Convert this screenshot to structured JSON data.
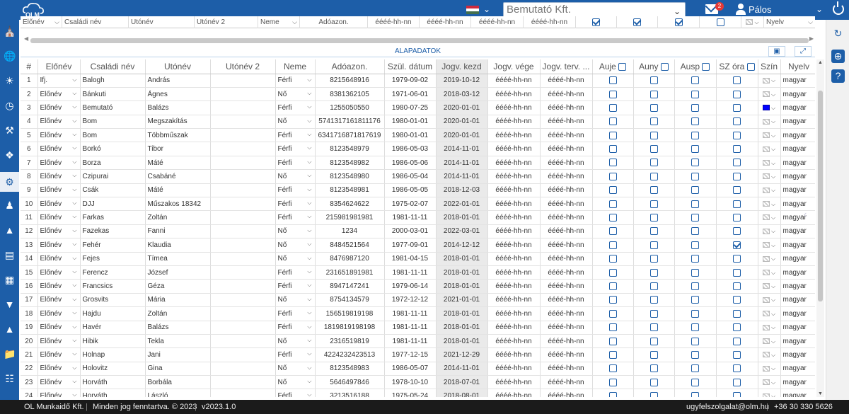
{
  "app": {
    "logo_text": "OLM",
    "company": "Bemutató Kft.",
    "mail_count": "2",
    "user_name": "Pálos"
  },
  "colors": {
    "brand": "#1d5ea8",
    "footer": "#1b1b1b",
    "badge": "#e53935",
    "jogv_bg": "#eaeaea"
  },
  "filter": {
    "eloneve": "Előnév",
    "csaladi": "Családi név",
    "utonev": "Utónév",
    "utonev2": "Utónév 2",
    "neme": "Neme",
    "adoazon": "Adóazon.",
    "date1": "éééé-hh-nn",
    "date2": "éééé-hh-nn",
    "date3": "éééé-hh-nn",
    "date4": "éééé-hh-nn",
    "nyelv": "Nyelv"
  },
  "section_title": "ALAPADATOK",
  "columns": {
    "idx": "#",
    "elonev": "Előnév",
    "csaladi": "Családi név",
    "utonev": "Utónév",
    "utonev2": "Utónév 2",
    "neme": "Neme",
    "adoazon": "Adóazon.",
    "szul": "Szül. dátum",
    "jogv_kezd": "Jogv. kezd",
    "jogv_vege": "Jogv. vége",
    "jogv_terv": "Jogv. terv. ...",
    "auje": "Auje",
    "auny": "Auny",
    "ausp": "Ausp",
    "sz_ora": "SZ óra",
    "szin": "Szín",
    "nyelv": "Nyelv"
  },
  "rows": [
    {
      "n": "1",
      "elonev": "Ifj.",
      "csaladi": "Balogh",
      "utonev": "András",
      "utonev2": "",
      "neme": "Férfi",
      "adoazon": "8215648916",
      "szul": "1979-09-02",
      "kezd": "2019-10-12",
      "vege": "éééé-hh-nn",
      "terv": "éééé-hh-nn",
      "sz": false,
      "blue": false,
      "nyelv": "magyar"
    },
    {
      "n": "2",
      "elonev": "Előnév",
      "csaladi": "Bánkuti",
      "utonev": "Ágnes",
      "utonev2": "",
      "neme": "Nő",
      "adoazon": "8381362105",
      "szul": "1971-06-01",
      "kezd": "2018-03-12",
      "vege": "éééé-hh-nn",
      "terv": "éééé-hh-nn",
      "sz": false,
      "blue": false,
      "nyelv": "magyar"
    },
    {
      "n": "3",
      "elonev": "Előnév",
      "csaladi": "Bemutató",
      "utonev": "Balázs",
      "utonev2": "",
      "neme": "Férfi",
      "adoazon": "1255050550",
      "szul": "1980-07-25",
      "kezd": "2020-01-01",
      "vege": "éééé-hh-nn",
      "terv": "éééé-hh-nn",
      "sz": false,
      "blue": true,
      "nyelv": "magyar"
    },
    {
      "n": "4",
      "elonev": "Előnév",
      "csaladi": "Bom",
      "utonev": "Megszakítás",
      "utonev2": "",
      "neme": "Nő",
      "adoazon": "5741317161811176",
      "szul": "1980-01-01",
      "kezd": "2020-01-01",
      "vege": "éééé-hh-nn",
      "terv": "éééé-hh-nn",
      "sz": false,
      "blue": false,
      "nyelv": "magyar"
    },
    {
      "n": "5",
      "elonev": "Előnév",
      "csaladi": "Bom",
      "utonev": "Többműszak",
      "utonev2": "",
      "neme": "Férfi",
      "adoazon": "6341716871817619",
      "szul": "1980-01-01",
      "kezd": "2020-01-01",
      "vege": "éééé-hh-nn",
      "terv": "éééé-hh-nn",
      "sz": false,
      "blue": false,
      "nyelv": "magyar"
    },
    {
      "n": "6",
      "elonev": "Előnév",
      "csaladi": "Borkó",
      "utonev": "Tibor",
      "utonev2": "",
      "neme": "Férfi",
      "adoazon": "8123548979",
      "szul": "1986-05-03",
      "kezd": "2014-11-01",
      "vege": "éééé-hh-nn",
      "terv": "éééé-hh-nn",
      "sz": false,
      "blue": false,
      "nyelv": "magyar"
    },
    {
      "n": "7",
      "elonev": "Előnév",
      "csaladi": "Borza",
      "utonev": "Máté",
      "utonev2": "",
      "neme": "Férfi",
      "adoazon": "8123548982",
      "szul": "1986-05-06",
      "kezd": "2014-11-01",
      "vege": "éééé-hh-nn",
      "terv": "éééé-hh-nn",
      "sz": false,
      "blue": false,
      "nyelv": "magyar"
    },
    {
      "n": "8",
      "elonev": "Előnév",
      "csaladi": "Czipurai",
      "utonev": "Csabáné",
      "utonev2": "",
      "neme": "Nő",
      "adoazon": "8123548980",
      "szul": "1986-05-04",
      "kezd": "2014-11-01",
      "vege": "éééé-hh-nn",
      "terv": "éééé-hh-nn",
      "sz": false,
      "blue": false,
      "nyelv": "magyar"
    },
    {
      "n": "9",
      "elonev": "Előnév",
      "csaladi": "Csák",
      "utonev": "Máté",
      "utonev2": "",
      "neme": "Férfi",
      "adoazon": "8123548981",
      "szul": "1986-05-05",
      "kezd": "2018-12-03",
      "vege": "éééé-hh-nn",
      "terv": "éééé-hh-nn",
      "sz": false,
      "blue": false,
      "nyelv": "magyar"
    },
    {
      "n": "10",
      "elonev": "Előnév",
      "csaladi": "DJJ",
      "utonev": "Műszakos 18342",
      "utonev2": "",
      "neme": "Férfi",
      "adoazon": "8354624622",
      "szul": "1975-02-07",
      "kezd": "2022-01-01",
      "vege": "éééé-hh-nn",
      "terv": "éééé-hh-nn",
      "sz": false,
      "blue": false,
      "nyelv": "magyar"
    },
    {
      "n": "11",
      "elonev": "Előnév",
      "csaladi": "Farkas",
      "utonev": "Zoltán",
      "utonev2": "",
      "neme": "Férfi",
      "adoazon": "215981981981",
      "szul": "1981-11-11",
      "kezd": "2018-01-01",
      "vege": "éééé-hh-nn",
      "terv": "éééé-hh-nn",
      "sz": false,
      "blue": false,
      "nyelv": "magyar"
    },
    {
      "n": "12",
      "elonev": "Előnév",
      "csaladi": "Fazekas",
      "utonev": "Fanni",
      "utonev2": "",
      "neme": "Nő",
      "adoazon": "1234",
      "szul": "2000-03-01",
      "kezd": "2022-03-01",
      "vege": "éééé-hh-nn",
      "terv": "éééé-hh-nn",
      "sz": false,
      "blue": false,
      "nyelv": "magyar"
    },
    {
      "n": "13",
      "elonev": "Előnév",
      "csaladi": "Fehér",
      "utonev": "Klaudia",
      "utonev2": "",
      "neme": "Nő",
      "adoazon": "8484521564",
      "szul": "1977-09-01",
      "kezd": "2014-12-12",
      "vege": "éééé-hh-nn",
      "terv": "éééé-hh-nn",
      "sz": true,
      "blue": false,
      "nyelv": "magyar"
    },
    {
      "n": "14",
      "elonev": "Előnév",
      "csaladi": "Fejes",
      "utonev": "Tímea",
      "utonev2": "",
      "neme": "Nő",
      "adoazon": "8476987120",
      "szul": "1981-04-15",
      "kezd": "2018-01-01",
      "vege": "éééé-hh-nn",
      "terv": "éééé-hh-nn",
      "sz": false,
      "blue": false,
      "nyelv": "magyar"
    },
    {
      "n": "15",
      "elonev": "Előnév",
      "csaladi": "Ferencz",
      "utonev": "József",
      "utonev2": "",
      "neme": "Férfi",
      "adoazon": "231651891981",
      "szul": "1981-11-11",
      "kezd": "2018-01-01",
      "vege": "éééé-hh-nn",
      "terv": "éééé-hh-nn",
      "sz": false,
      "blue": false,
      "nyelv": "magyar"
    },
    {
      "n": "16",
      "elonev": "Előnév",
      "csaladi": "Francsics",
      "utonev": "Géza",
      "utonev2": "",
      "neme": "Férfi",
      "adoazon": "8947147241",
      "szul": "1979-06-14",
      "kezd": "2018-01-01",
      "vege": "éééé-hh-nn",
      "terv": "éééé-hh-nn",
      "sz": false,
      "blue": false,
      "nyelv": "magyar"
    },
    {
      "n": "17",
      "elonev": "Előnév",
      "csaladi": "Grosvits",
      "utonev": "Mária",
      "utonev2": "",
      "neme": "Nő",
      "adoazon": "8754134579",
      "szul": "1972-12-12",
      "kezd": "2021-01-01",
      "vege": "éééé-hh-nn",
      "terv": "éééé-hh-nn",
      "sz": false,
      "blue": false,
      "nyelv": "magyar"
    },
    {
      "n": "18",
      "elonev": "Előnév",
      "csaladi": "Hajdu",
      "utonev": "Zoltán",
      "utonev2": "",
      "neme": "Férfi",
      "adoazon": "156519819198",
      "szul": "1981-11-11",
      "kezd": "2018-01-01",
      "vege": "éééé-hh-nn",
      "terv": "éééé-hh-nn",
      "sz": false,
      "blue": false,
      "nyelv": "magyar"
    },
    {
      "n": "19",
      "elonev": "Előnév",
      "csaladi": "Havér",
      "utonev": "Balázs",
      "utonev2": "",
      "neme": "Férfi",
      "adoazon": "1819819198198",
      "szul": "1981-11-11",
      "kezd": "2018-01-01",
      "vege": "éééé-hh-nn",
      "terv": "éééé-hh-nn",
      "sz": false,
      "blue": false,
      "nyelv": "magyar"
    },
    {
      "n": "20",
      "elonev": "Előnév",
      "csaladi": "Hibik",
      "utonev": "Tekla",
      "utonev2": "",
      "neme": "Nő",
      "adoazon": "2316519819",
      "szul": "1981-11-11",
      "kezd": "2018-01-01",
      "vege": "éééé-hh-nn",
      "terv": "éééé-hh-nn",
      "sz": false,
      "blue": false,
      "nyelv": "magyar"
    },
    {
      "n": "21",
      "elonev": "Előnév",
      "csaladi": "Holnap",
      "utonev": "Jani",
      "utonev2": "",
      "neme": "Férfi",
      "adoazon": "4224232423513",
      "szul": "1977-12-15",
      "kezd": "2021-12-29",
      "vege": "éééé-hh-nn",
      "terv": "éééé-hh-nn",
      "sz": false,
      "blue": false,
      "nyelv": "magyar"
    },
    {
      "n": "22",
      "elonev": "Előnév",
      "csaladi": "Holovitz",
      "utonev": "Gina",
      "utonev2": "",
      "neme": "Nő",
      "adoazon": "8123548983",
      "szul": "1986-05-07",
      "kezd": "2014-11-01",
      "vege": "éééé-hh-nn",
      "terv": "éééé-hh-nn",
      "sz": false,
      "blue": false,
      "nyelv": "magyar"
    },
    {
      "n": "23",
      "elonev": "Előnév",
      "csaladi": "Horváth",
      "utonev": "Borbála",
      "utonev2": "",
      "neme": "Nő",
      "adoazon": "5646497846",
      "szul": "1978-10-10",
      "kezd": "2018-07-01",
      "vege": "éééé-hh-nn",
      "terv": "éééé-hh-nn",
      "sz": false,
      "blue": false,
      "nyelv": "magyar"
    },
    {
      "n": "24",
      "elonev": "Előnév",
      "csaladi": "Horváth",
      "utonev": "László",
      "utonev2": "",
      "neme": "Férfi",
      "adoazon": "3213516188",
      "szul": "1975-05-24",
      "kezd": "2018-08-01",
      "vege": "éééé-hh-nn",
      "terv": "éééé-hh-nn",
      "sz": false,
      "blue": false,
      "nyelv": "magyar"
    }
  ],
  "footer": {
    "company": "OL Munkaidő Kft.",
    "rights": "Minden jog fenntartva. © 2023",
    "version": "v2023.1.0",
    "email": "ugyfelszolgalat@olm.hu",
    "phone": "+36 30 330 5626"
  }
}
